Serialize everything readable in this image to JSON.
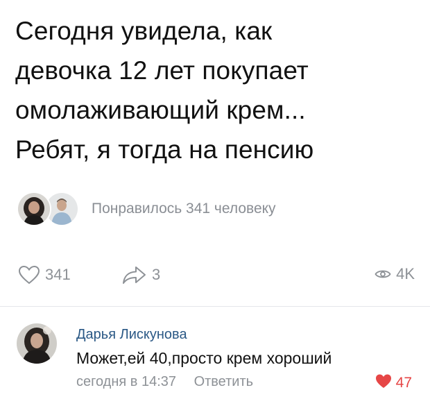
{
  "post": {
    "lines": [
      "Сегодня увидела, как",
      "девочка 12 лет покупает",
      "омолаживающий крем...",
      "Ребят, я тогда на пенсию"
    ]
  },
  "likers": {
    "text": "Понравилось 341 человеку",
    "avatars": [
      "liker-avatar-1",
      "liker-avatar-2"
    ]
  },
  "actions": {
    "likes": "341",
    "shares": "3",
    "views": "4K",
    "like_icon": "heart-outline-icon",
    "share_icon": "share-arrow-icon",
    "views_icon": "eye-icon"
  },
  "comment": {
    "author": "Дарья Лискунова",
    "text": "Может,ей 40,просто крем хороший",
    "time": "сегодня в 14:37",
    "reply": "Ответить",
    "likes": "47",
    "like_icon": "heart-filled-icon"
  },
  "colors": {
    "link": "#2a5885",
    "muted": "#8d9196",
    "like_active": "#e64646"
  }
}
